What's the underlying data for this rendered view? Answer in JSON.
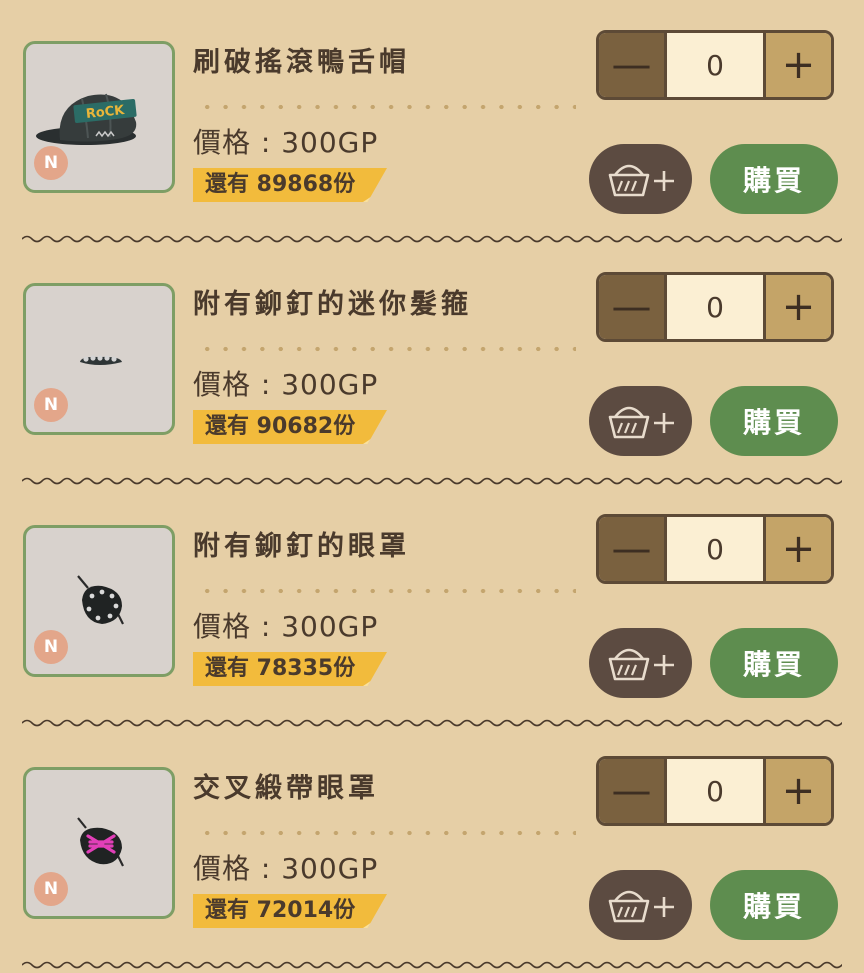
{
  "colors": {
    "background": "#e6cfa6",
    "thumb_border": "#7e9e65",
    "rarity_badge": "#e3a68a",
    "stock_tag": "#f2bb3c",
    "buy_button": "#5e8d4f",
    "cart_button": "#5c4b41",
    "stepper_minus": "#7a613f",
    "stepper_plus": "#c4a468"
  },
  "labels": {
    "rarity": "N",
    "minus": "—",
    "plus": "+",
    "buy": "購買",
    "cart_icon": "basket-plus-icon"
  },
  "items": [
    {
      "name": "刷破搖滾鴨舌帽",
      "price": "價格 : 300GP",
      "stock": "還有 89868份",
      "quantity": "0",
      "thumbnail_icon": "rock-cap-icon",
      "cap_text": "RoCK"
    },
    {
      "name": "附有鉚釘的迷你髮箍",
      "price": "價格 : 300GP",
      "stock": "還有 90682份",
      "quantity": "0",
      "thumbnail_icon": "studded-headband-icon"
    },
    {
      "name": "附有鉚釘的眼罩",
      "price": "價格 : 300GP",
      "stock": "還有 78335份",
      "quantity": "0",
      "thumbnail_icon": "studded-eyepatch-icon"
    },
    {
      "name": "交叉緞帶眼罩",
      "price": "價格 : 300GP",
      "stock": "還有 72014份",
      "quantity": "0",
      "thumbnail_icon": "cross-ribbon-eyepatch-icon"
    }
  ]
}
